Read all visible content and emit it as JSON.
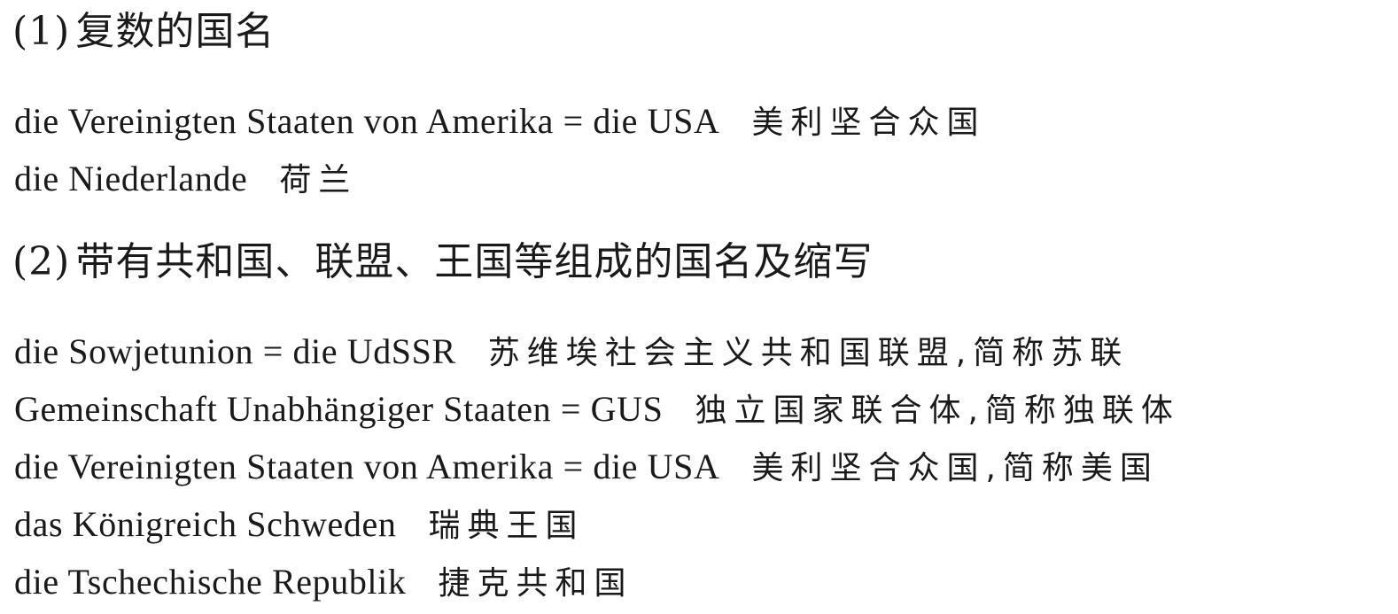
{
  "sections": [
    {
      "number": "(1)",
      "title": "复数的国名",
      "entries": [
        {
          "german": "die Vereinigten Staaten von Amerika = die USA",
          "chinese": "美利坚合众国"
        },
        {
          "german": "die Niederlande",
          "chinese": "荷兰"
        }
      ]
    },
    {
      "number": "(2)",
      "title": "带有共和国、联盟、王国等组成的国名及缩写",
      "entries": [
        {
          "german": "die Sowjetunion = die UdSSR",
          "chinese": "苏维埃社会主义共和国联盟,简称苏联"
        },
        {
          "german": "Gemeinschaft Unabhängiger Staaten = GUS",
          "chinese": "独立国家联合体,简称独联体"
        },
        {
          "german": "die Vereinigten Staaten von Amerika = die USA",
          "chinese": "美利坚合众国,简称美国"
        },
        {
          "german": "das Königreich Schweden",
          "chinese": "瑞典王国"
        },
        {
          "german": "die Tschechische Republik",
          "chinese": "捷克共和国"
        }
      ]
    }
  ]
}
